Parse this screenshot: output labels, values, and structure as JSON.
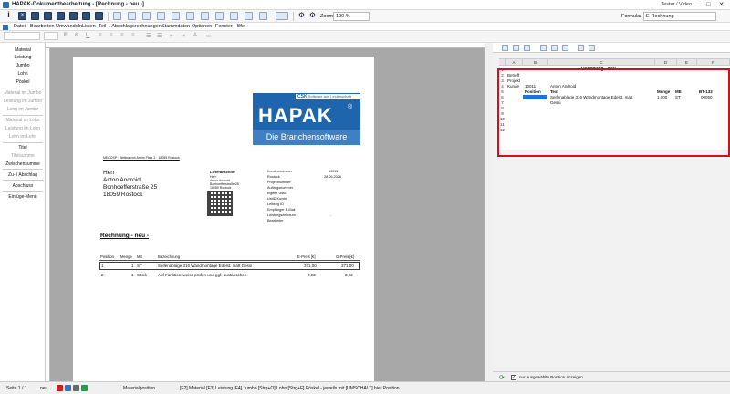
{
  "window": {
    "title": "HAPAK-Dokumentbearbeitung - [Rechnung - neu -]",
    "user": "Tester / Video",
    "minimize_glyph": "–",
    "maximize_glyph": "□",
    "close_glyph": "✕"
  },
  "toolbar": {
    "zoom_label": "Zoom",
    "zoom_value": "100 %",
    "formular_label": "Formular",
    "formular_value": "E-Rechnung"
  },
  "menu": [
    "Datei",
    "Bearbeiten",
    "Umwandeln",
    "Listen",
    "Teil- / Abschlagsrechnungen",
    "Stammdaten",
    "Optionen",
    "Fenster",
    "Hilfe"
  ],
  "sidebar": {
    "items": [
      {
        "label": "Material",
        "enabled": true
      },
      {
        "label": "Leistung",
        "enabled": true
      },
      {
        "label": "Jumbo",
        "enabled": true
      },
      {
        "label": "Lohn",
        "enabled": true
      },
      {
        "label": "Pöskel",
        "enabled": true
      },
      {
        "label": "Material im Jumbo",
        "enabled": false
      },
      {
        "label": "Leistung im Jumbo",
        "enabled": false
      },
      {
        "label": "Lohn im Jumbo",
        "enabled": false
      },
      {
        "label": "Material im Lohn",
        "enabled": false
      },
      {
        "label": "Leistung im Lohn",
        "enabled": false
      },
      {
        "label": "Lohn im Lohn",
        "enabled": false
      },
      {
        "label": "Titel",
        "enabled": true
      },
      {
        "label": "Titelsumme",
        "enabled": false
      },
      {
        "label": "Zwischensumme",
        "enabled": true
      },
      {
        "label": "Zu- / Abschlag",
        "enabled": true
      },
      {
        "label": "Abschluss",
        "enabled": true
      },
      {
        "label": "Einfüge-Menü",
        "enabled": true
      }
    ]
  },
  "document": {
    "logo": {
      "badge": "CSK",
      "badge_sub": "Software aus Leidenschaft",
      "name": "HAPAK",
      "reg": "®",
      "tagline": "Die Branchensoftware"
    },
    "sender_line": "MECOSP · Bettina von Arnim Platz 2 · 18055 Rostock",
    "recipient": [
      "Herr",
      "Anton Android",
      "Bonhoefferstraße 25",
      "18059 Rostock"
    ],
    "delivery_title": "Lieferanschrift",
    "delivery": [
      "Herr",
      "Anton Android",
      "Bonhoefferstraße 25",
      "18059 Rostock"
    ],
    "info_labels": [
      "Kundennummer",
      "Rostock",
      "Projektnummer",
      "Auftragsnummer",
      "eigene UstID",
      "UstID Kunde",
      "Leitweg ID",
      "Empfänger E-Mail",
      "Leistungszeitraum",
      "Bearbeiter"
    ],
    "info_values": [
      "10011",
      "28.06.2026",
      "",
      "",
      "",
      "",
      "",
      "",
      "-",
      ""
    ],
    "heading": "Rechnung - neu -",
    "table_headers": {
      "position": "Position",
      "menge": "Menge",
      "me": "ME",
      "bezeichnung": "Bezeichnung",
      "epreis": "E-Preis [€]",
      "gpreis": "G-Preis [€]"
    },
    "rows": [
      {
        "position": "1",
        "menge": "1",
        "me": "ST",
        "bezeichnung": "Seifenablage 316 Wandmontage Edelst. matt Gessi",
        "epreis": "371,00",
        "gpreis": "371,00"
      },
      {
        "position": "2",
        "menge": "1",
        "me": "Stück",
        "bezeichnung": "Auf Funktionsweise prüfen und ggf. austauschen.",
        "epreis": "2,92",
        "gpreis": "2,92"
      }
    ]
  },
  "sheet": {
    "columns": [
      "A",
      "B",
      "C",
      "D",
      "E",
      "F"
    ],
    "rows": [
      "1",
      "2",
      "3",
      "4",
      "5",
      "6",
      "7",
      "8",
      "9",
      "10",
      "11",
      "12"
    ],
    "title": "Rechnung - neu -",
    "betreff_label": "Betreff",
    "projekt_label": "Projekt",
    "kunde_label": "Kunde",
    "kunde_number": "10011",
    "kunde_name": "Anton Android",
    "header": {
      "position": "Position",
      "text": "Text",
      "menge": "Menge",
      "me": "ME",
      "bt": "BT-132"
    },
    "line": {
      "text1": "Seifenablage 316 Wandmontage Edelst. matt",
      "text2": "Gessi",
      "menge": "1,000",
      "me": "ST",
      "bt": "00050"
    },
    "checkbox_label": "nur ausgewählte Position anzeigen"
  },
  "statusbar": {
    "page": "Seite 1 / 1",
    "mode": "neu",
    "position": "Materialposition",
    "shortcuts": "[F2] Material  [F3] Leistung  [F4] Jumbo  [Strg+O] Lohn  [Strg+F] Pöskel - jeweils mit [UMSCHALT] hier Position"
  }
}
